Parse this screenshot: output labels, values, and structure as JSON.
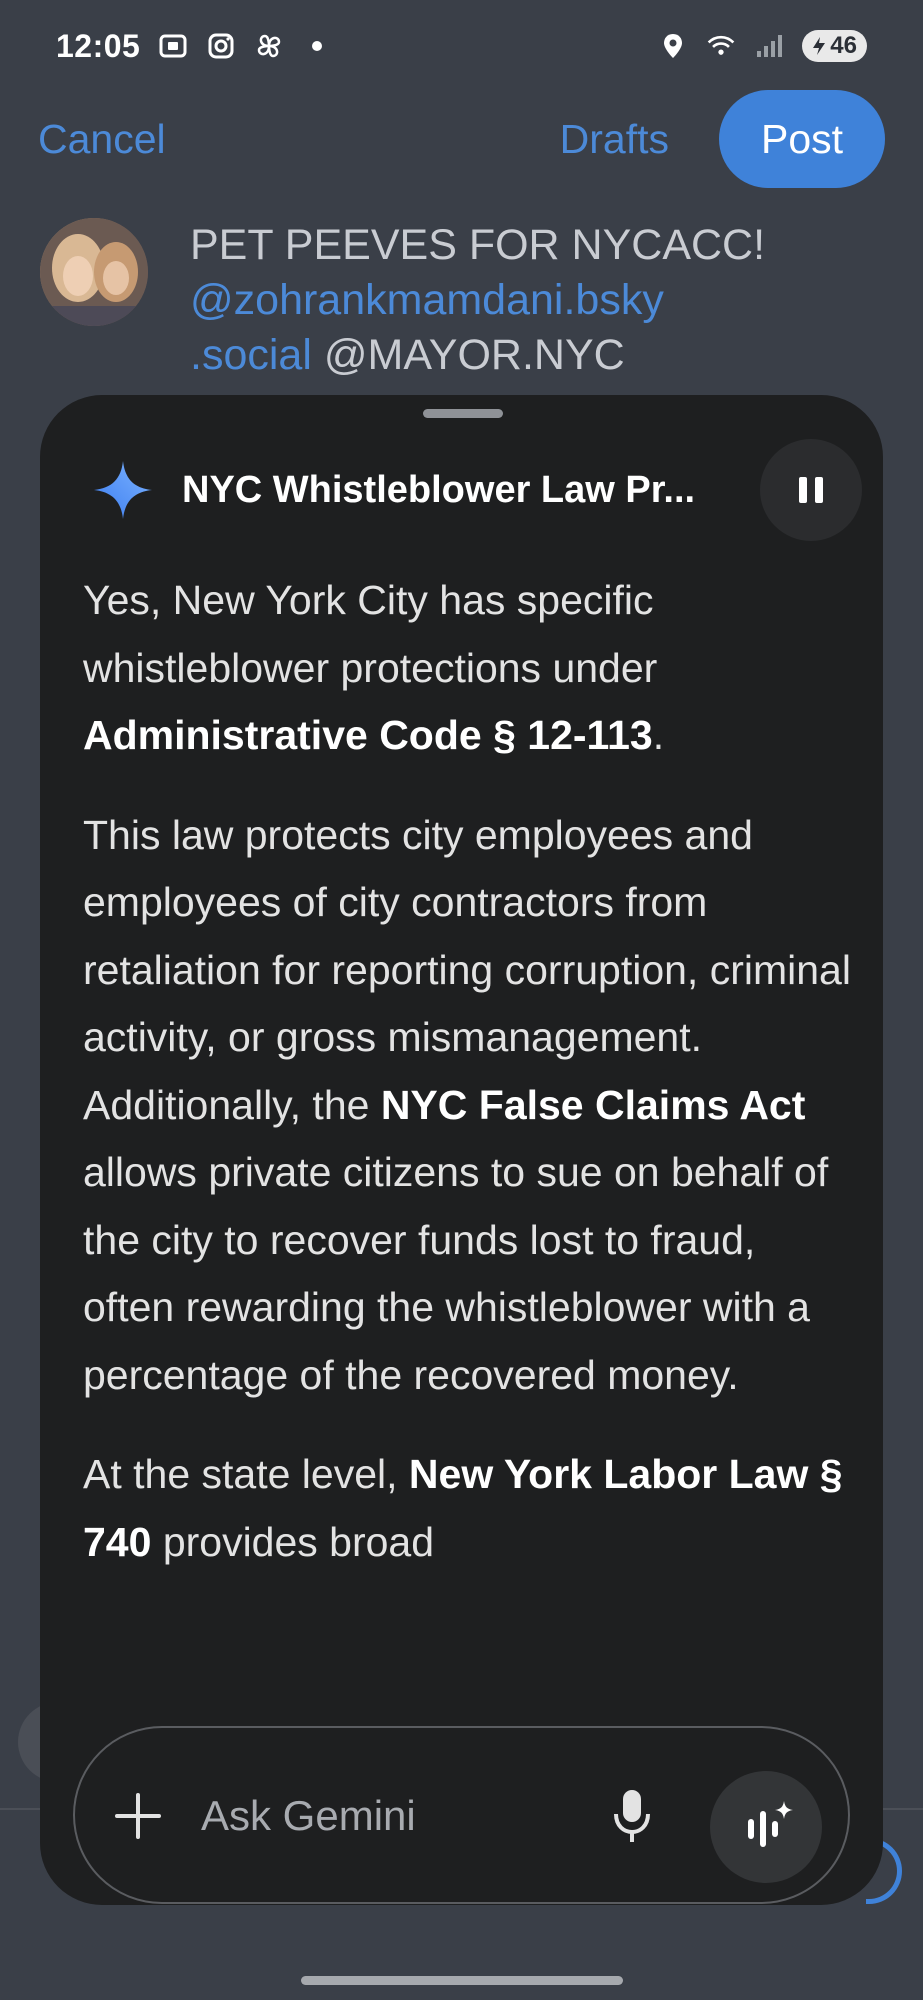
{
  "status_bar": {
    "time": "12:05",
    "battery": "46",
    "icons": [
      "screenshot-icon",
      "instagram-icon",
      "pinwheel-icon",
      "dot-icon",
      "location-icon",
      "wifi-icon",
      "signal-icon",
      "battery-icon"
    ]
  },
  "compose": {
    "cancel_label": "Cancel",
    "drafts_label": "Drafts",
    "post_label": "Post",
    "post_text": "PET PEEVES FOR NYCACC!",
    "mention_1": "@zohrankmamdani.bsky.social",
    "mention_1_line1": "@zohrankmamdani.bsky",
    "mention_1_line2": ".social",
    "mention_2": "@MAYOR.NYC"
  },
  "gemini": {
    "title": "NYC Whistleblower Law Pr...",
    "paragraphs": [
      {
        "t1": "Yes, New York City has specific whistleblower protections under ",
        "b1": "Administrative Code § 12-113",
        "t2": "."
      },
      {
        "t1": "This law protects city employees and employees of city contractors from retaliation for reporting corruption, criminal activity, or gross mismanagement. Additionally, the ",
        "b1": "NYC False Claims Act",
        "t2": " allows private citizens to sue on behalf of the city to recover funds lost to fraud, often rewarding the whistleblower with a percentage of the recovered money."
      },
      {
        "t1": "At the state level, ",
        "b1": "New York Labor Law § 740",
        "t2": " provides broad"
      }
    ],
    "input_placeholder": "Ask Gemini"
  },
  "colors": {
    "background": "#3a3f48",
    "sheet": "#1e1f20",
    "accent": "#3f82d9",
    "link": "#4c8ad8"
  }
}
